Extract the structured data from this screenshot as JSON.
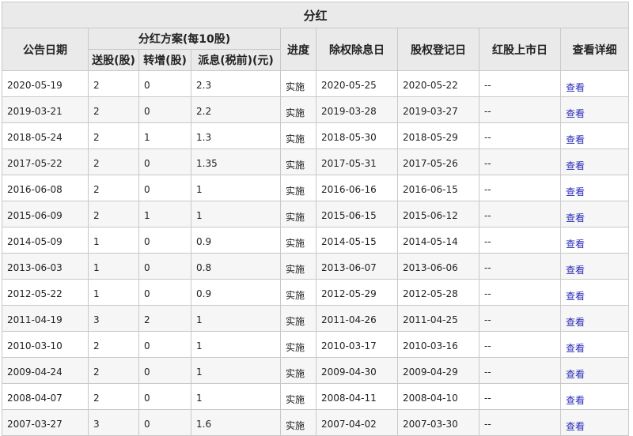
{
  "title": "分红",
  "headers": {
    "announce_date": "公告日期",
    "plan_group": "分红方案(每10股)",
    "bonus_shares": "送股(股)",
    "transfer_shares": "转增(股)",
    "cash_dividend": "派息(税前)(元)",
    "progress": "进度",
    "ex_date": "除权除息日",
    "record_date": "股权登记日",
    "bonus_listing_date": "红股上市日",
    "details": "查看详细"
  },
  "rows": [
    {
      "announce": "2020-05-19",
      "bonus": "2",
      "transfer": "0",
      "cash": "2.3",
      "status": "实施",
      "ex": "2020-05-25",
      "record": "2020-05-22",
      "listing": "--",
      "link": "查看"
    },
    {
      "announce": "2019-03-21",
      "bonus": "2",
      "transfer": "0",
      "cash": "2.2",
      "status": "实施",
      "ex": "2019-03-28",
      "record": "2019-03-27",
      "listing": "--",
      "link": "查看"
    },
    {
      "announce": "2018-05-24",
      "bonus": "2",
      "transfer": "1",
      "cash": "1.3",
      "status": "实施",
      "ex": "2018-05-30",
      "record": "2018-05-29",
      "listing": "--",
      "link": "查看"
    },
    {
      "announce": "2017-05-22",
      "bonus": "2",
      "transfer": "0",
      "cash": "1.35",
      "status": "实施",
      "ex": "2017-05-31",
      "record": "2017-05-26",
      "listing": "--",
      "link": "查看"
    },
    {
      "announce": "2016-06-08",
      "bonus": "2",
      "transfer": "0",
      "cash": "1",
      "status": "实施",
      "ex": "2016-06-16",
      "record": "2016-06-15",
      "listing": "--",
      "link": "查看"
    },
    {
      "announce": "2015-06-09",
      "bonus": "2",
      "transfer": "1",
      "cash": "1",
      "status": "实施",
      "ex": "2015-06-15",
      "record": "2015-06-12",
      "listing": "--",
      "link": "查看"
    },
    {
      "announce": "2014-05-09",
      "bonus": "1",
      "transfer": "0",
      "cash": "0.9",
      "status": "实施",
      "ex": "2014-05-15",
      "record": "2014-05-14",
      "listing": "--",
      "link": "查看"
    },
    {
      "announce": "2013-06-03",
      "bonus": "1",
      "transfer": "0",
      "cash": "0.8",
      "status": "实施",
      "ex": "2013-06-07",
      "record": "2013-06-06",
      "listing": "--",
      "link": "查看"
    },
    {
      "announce": "2012-05-22",
      "bonus": "1",
      "transfer": "0",
      "cash": "0.9",
      "status": "实施",
      "ex": "2012-05-29",
      "record": "2012-05-28",
      "listing": "--",
      "link": "查看"
    },
    {
      "announce": "2011-04-19",
      "bonus": "3",
      "transfer": "2",
      "cash": "1",
      "status": "实施",
      "ex": "2011-04-26",
      "record": "2011-04-25",
      "listing": "--",
      "link": "查看"
    },
    {
      "announce": "2010-03-10",
      "bonus": "2",
      "transfer": "0",
      "cash": "1",
      "status": "实施",
      "ex": "2010-03-17",
      "record": "2010-03-16",
      "listing": "--",
      "link": "查看"
    },
    {
      "announce": "2009-04-24",
      "bonus": "2",
      "transfer": "0",
      "cash": "1",
      "status": "实施",
      "ex": "2009-04-30",
      "record": "2009-04-29",
      "listing": "--",
      "link": "查看"
    },
    {
      "announce": "2008-04-07",
      "bonus": "2",
      "transfer": "0",
      "cash": "1",
      "status": "实施",
      "ex": "2008-04-11",
      "record": "2008-04-10",
      "listing": "--",
      "link": "查看"
    },
    {
      "announce": "2007-03-27",
      "bonus": "3",
      "transfer": "0",
      "cash": "1.6",
      "status": "实施",
      "ex": "2007-04-02",
      "record": "2007-03-30",
      "listing": "--",
      "link": "查看"
    }
  ]
}
